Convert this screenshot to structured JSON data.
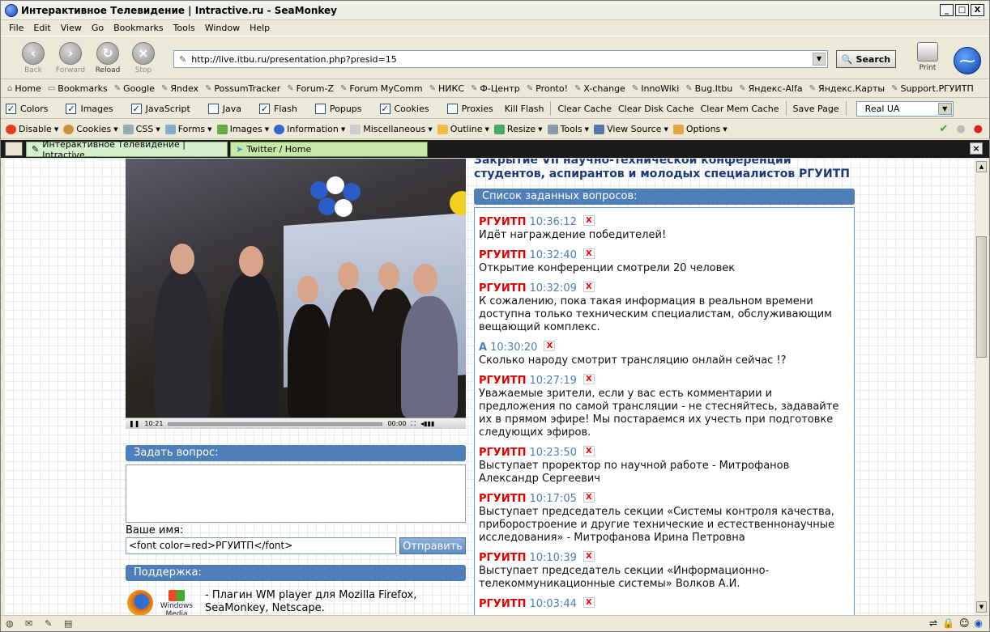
{
  "window": {
    "title": "Интерактивное Телевидение | Intractive.ru - SeaMonkey",
    "min": "_",
    "max": "□",
    "close": "X"
  },
  "menu": [
    "File",
    "Edit",
    "View",
    "Go",
    "Bookmarks",
    "Tools",
    "Window",
    "Help"
  ],
  "nav": {
    "back": "Back",
    "forward": "Forward",
    "reload": "Reload",
    "stop": "Stop",
    "url": "http://live.itbu.ru/presentation.php?presid=15",
    "search": "Search",
    "print": "Print"
  },
  "bookmarks": [
    "Home",
    "Bookmarks",
    "Google",
    "Яndex",
    "PossumTracker",
    "Forum-Z",
    "Forum MyComm",
    "НИКС",
    "Ф-Центр",
    "Pronto!",
    "X-change",
    "InnoWiki",
    "Bug.Itbu",
    "Яндекс-Alfa",
    "Яндекс.Карты",
    "Support.РГУИТП"
  ],
  "webdev": {
    "checks": [
      {
        "label": "Colors",
        "checked": "✓"
      },
      {
        "label": "Images",
        "checked": "✓"
      },
      {
        "label": "JavaScript",
        "checked": "✓"
      },
      {
        "label": "Java",
        "checked": ""
      },
      {
        "label": "Flash",
        "checked": "✓"
      },
      {
        "label": "Popups",
        "checked": ""
      },
      {
        "label": "Cookies",
        "checked": "✓"
      },
      {
        "label": "Proxies",
        "checked": ""
      }
    ],
    "kill_flash": "Kill Flash",
    "clear_cache": "Clear Cache",
    "clear_disk": "Clear Disk Cache",
    "clear_mem": "Clear Mem Cache",
    "save_page": "Save Page",
    "ua": "Real UA"
  },
  "webdev2": [
    "Disable",
    "Cookies",
    "CSS",
    "Forms",
    "Images",
    "Information",
    "Miscellaneous",
    "Outline",
    "Resize",
    "Tools",
    "View Source",
    "Options"
  ],
  "tabs": [
    {
      "label": "Интерактивное Телевидение | Intractive...."
    },
    {
      "label": "Twitter / Home"
    }
  ],
  "page": {
    "headline": "Закрытие VII научно-технической конференции студентов, аспирантов и молодых специалистов РГУИТП",
    "video_time": "10:21",
    "video_end": "00:00",
    "ask_label": "Задать вопрос:",
    "name_label": "Ваше имя:",
    "name_value": "<font color=red>РГУИТП</font>",
    "send": "Отправить",
    "support_label": "Поддержка:",
    "support_text": "- Плагин WM player для Mozilla Firefox, SeaMonkey, Netscape.",
    "wmp_text": "Windows Media Player",
    "questions_label": "Список заданных вопросов:",
    "questions": [
      {
        "author": "РГУИТП",
        "time": "10:36:12",
        "text": "Идёт награждение победителей!"
      },
      {
        "author": "РГУИТП",
        "time": "10:32:40",
        "text": "Открытие конференции смотрели 20 человек"
      },
      {
        "author": "РГУИТП",
        "time": "10:32:09",
        "text": "К сожалению, пока такая информация в реальном времени доступна только техническим специалистам, обслуживающим вещающий комплекс."
      },
      {
        "author": "А",
        "time": "10:30:20",
        "text": "Сколько народу смотрит трансляцию онлайн сейчас !?"
      },
      {
        "author": "РГУИТП",
        "time": "10:27:19",
        "text": "Уважаемые зрители, если у вас есть комментарии и предложения по самой трансляции - не стесняйтесь, задавайте их в прямом эфире! Мы постараемся их учесть при подготовке следующих эфиров."
      },
      {
        "author": "РГУИТП",
        "time": "10:23:50",
        "text": "Выступает проректор по научной работе - Митрофанов Александр Сергеевич"
      },
      {
        "author": "РГУИТП",
        "time": "10:17:05",
        "text": "Выступает председатель секции «Системы контроля качества, приборостроение и другие технические и естественнонаучные исследования» - Митрофанова Ирина Петровна"
      },
      {
        "author": "РГУИТП",
        "time": "10:10:39",
        "text": "Выступает председатель секции «Информационно-телекоммуникационные системы» Волков А.И."
      },
      {
        "author": "РГУИТП",
        "time": "10:03:44",
        "text": ""
      }
    ],
    "x": "X"
  },
  "colors": {
    "accent": "#4f7fb8",
    "author_red": "#e00000",
    "time_blue": "#4a7fb8"
  }
}
